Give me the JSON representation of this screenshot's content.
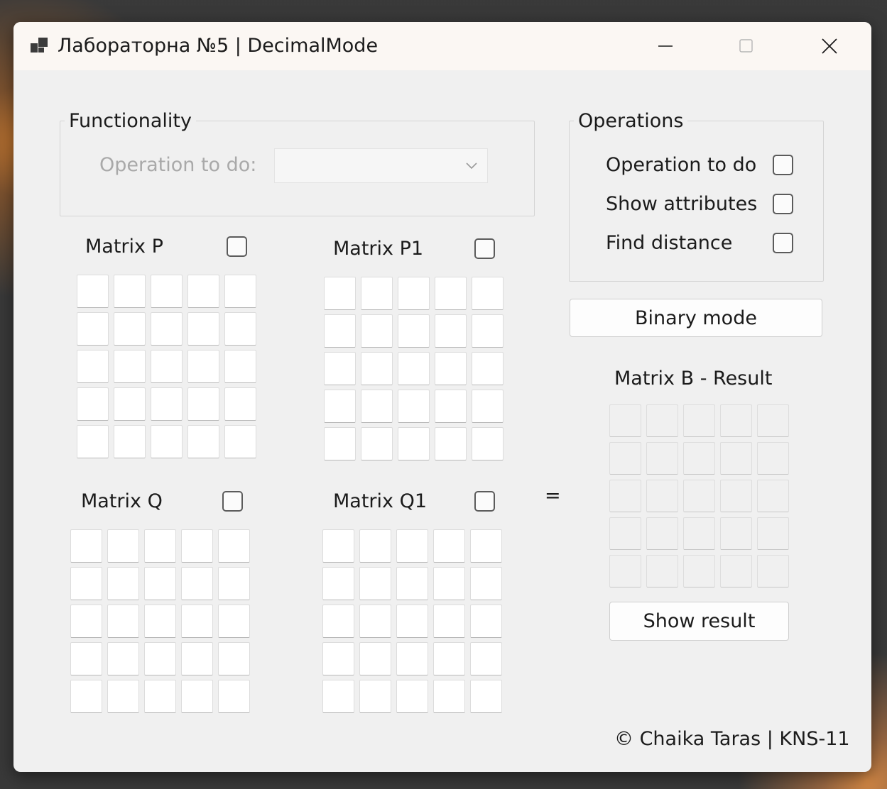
{
  "window": {
    "title": "Лабораторна №5 | DecimalMode",
    "controls": [
      "minimize",
      "maximize",
      "close"
    ]
  },
  "functionality": {
    "title": "Functionality",
    "operation_label": "Operation to do:",
    "operation_value": ""
  },
  "operations": {
    "title": "Operations",
    "items": [
      {
        "label": "Operation to do",
        "checked": false
      },
      {
        "label": "Show attributes",
        "checked": false
      },
      {
        "label": "Find distance",
        "checked": false
      }
    ]
  },
  "binary_mode_button": "Binary mode",
  "matrices": {
    "p": {
      "label": "Matrix P",
      "checked": false
    },
    "p1": {
      "label": "Matrix P1",
      "checked": false
    },
    "q": {
      "label": "Matrix Q",
      "checked": false
    },
    "q1": {
      "label": "Matrix Q1",
      "checked": false
    }
  },
  "equals_sign": "=",
  "result": {
    "label": "Matrix B - Result",
    "button": "Show result"
  },
  "footer": "© Chaika Taras | KNS-11"
}
